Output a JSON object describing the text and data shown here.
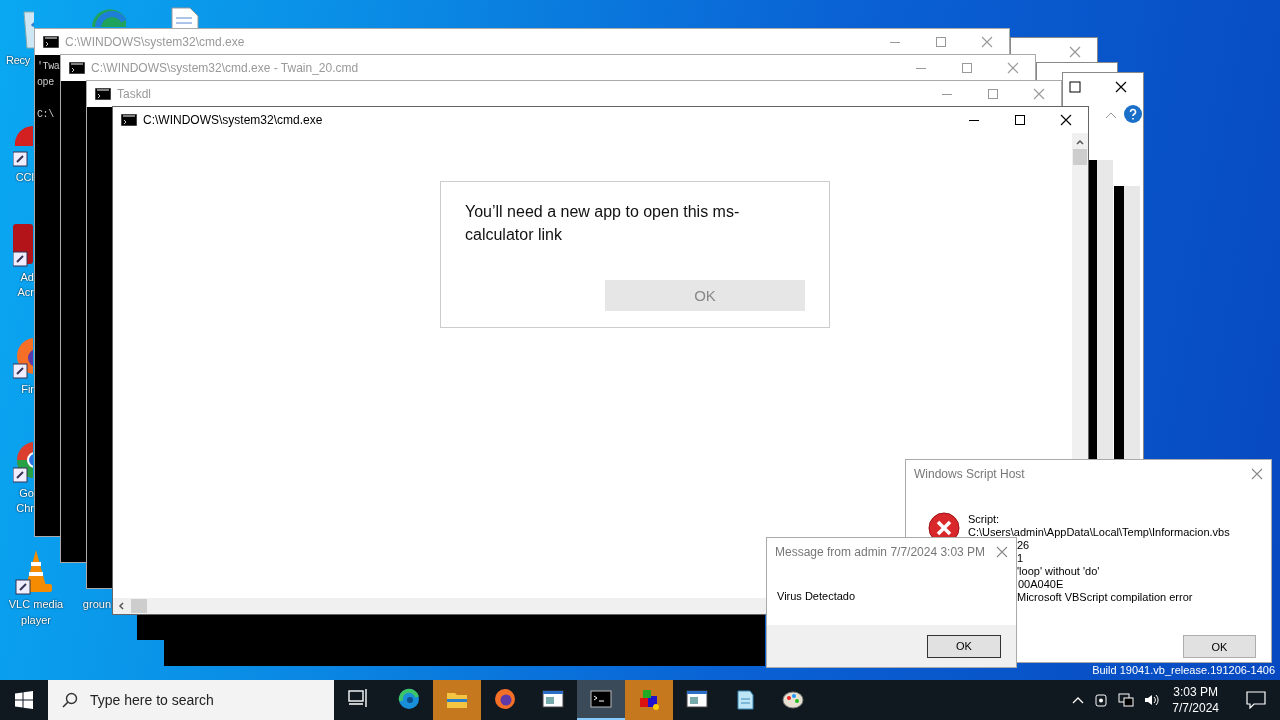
{
  "desktop": {
    "icons": [
      {
        "kind": "recycle",
        "lines": [
          "Recy"
        ]
      },
      {
        "kind": "edge"
      },
      {
        "kind": "file"
      },
      {
        "kind": "ccleaner",
        "lines": [
          "CCl"
        ]
      },
      {
        "kind": "acrobat",
        "lines": [
          "Ad",
          "Acr"
        ]
      },
      {
        "kind": "firefox",
        "lines": [
          "Fir"
        ]
      },
      {
        "kind": "chrome",
        "lines": [
          "Go",
          "Chr"
        ]
      },
      {
        "kind": "vlc",
        "lines": [
          "VLC media",
          "player"
        ]
      },
      {
        "kind": "hidden",
        "lines": [
          "groun"
        ]
      }
    ],
    "build_text": "Build 19041.vb_release.191206-1406"
  },
  "windows": [
    {
      "title": "C:\\WINDOWS\\system32\\cmd.exe",
      "active": false,
      "console_text": "'Twa\nope\n\nC:\\"
    },
    {
      "title": "C:\\WINDOWS\\system32\\cmd.exe - Twain_20.cmd",
      "active": false
    },
    {
      "title": "Taskdl",
      "active": false
    },
    {
      "title": "C:\\WINDOWS\\system32\\cmd.exe",
      "active": true
    }
  ],
  "app_dialog": {
    "message": "You’ll need a new app to open this ms-calculator link",
    "button": {
      "label": "OK",
      "disabled": true
    }
  },
  "script_host_dialog": {
    "title": "Windows Script Host",
    "lines": [
      "Script:",
      "C:\\Users\\admin\\AppData\\Local\\Temp\\Informacion.vbs"
    ],
    "values": [
      "26",
      "1",
      "'loop' without 'do'",
      "00A040E",
      "Microsoft VBScript compilation error"
    ],
    "button": "OK"
  },
  "message_dialog": {
    "title": "Message from admin 7/7/2024 3:03 PM",
    "message": "Virus Detectado",
    "button": "OK"
  },
  "taskbar": {
    "search": {
      "placeholder": "Type here to search"
    },
    "apps": [
      {
        "kind": "taskview",
        "selected": false,
        "flashing": false
      },
      {
        "kind": "edge",
        "selected": false,
        "flashing": false
      },
      {
        "kind": "explorer",
        "selected": false,
        "flashing": true
      },
      {
        "kind": "firefox",
        "selected": false,
        "flashing": false
      },
      {
        "kind": "window",
        "selected": false,
        "flashing": false
      },
      {
        "kind": "terminal",
        "selected": true,
        "flashing": false
      },
      {
        "kind": "setup",
        "selected": false,
        "flashing": true
      },
      {
        "kind": "window",
        "selected": false,
        "flashing": false
      },
      {
        "kind": "notepad",
        "selected": false,
        "flashing": false
      },
      {
        "kind": "paint",
        "selected": false,
        "flashing": false
      }
    ],
    "time": "3:03 PM",
    "date": "7/7/2024"
  }
}
